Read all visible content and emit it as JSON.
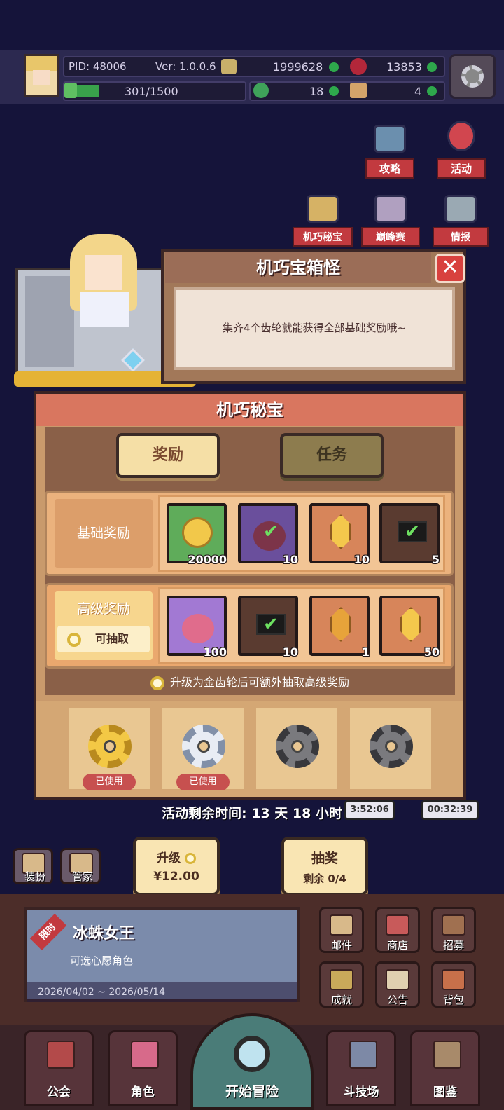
{
  "topbar": {
    "pid": "PID: 48006",
    "version": "Ver: 1.0.0.6",
    "gold": "1999628",
    "gems": "13853",
    "stamina": "301/1500",
    "clover": "18",
    "item": "4"
  },
  "side": {
    "guide": "攻略",
    "activity": "活动",
    "secret": "机巧秘宝",
    "peak": "巅峰赛",
    "intel": "情报"
  },
  "dialog": {
    "title": "机巧宝箱怪",
    "message": "集齐4个齿轮就能获得全部基础奖励哦~"
  },
  "panel": {
    "title": "机巧秘宝",
    "tab_reward": "奖励",
    "tab_task": "任务",
    "basic_label": "基础奖励",
    "advanced_label": "高级奖励",
    "draw_label": "可抽取",
    "basic_items": [
      {
        "name": "gold-coin",
        "count": "20000"
      },
      {
        "name": "purple-fruit",
        "count": "10"
      },
      {
        "name": "gold-crystal",
        "count": "10"
      },
      {
        "name": "check-ticket",
        "count": "5"
      }
    ],
    "advanced_items": [
      {
        "name": "pink-fruit",
        "count": "100"
      },
      {
        "name": "check-ticket",
        "count": "10"
      },
      {
        "name": "amber-crystal",
        "count": "1"
      },
      {
        "name": "gold-crystal",
        "count": "50"
      }
    ],
    "hint": "升级为金齿轮后可额外抽取高级奖励",
    "gears": [
      {
        "type": "gold",
        "status": "已使用"
      },
      {
        "type": "silver",
        "status": "已使用"
      },
      {
        "type": "gray",
        "status": ""
      },
      {
        "type": "gray",
        "status": ""
      }
    ]
  },
  "remaining_time": "活动剩余时间: 13 天 18 小时",
  "timers": [
    "3:52:06",
    "00:32:39"
  ],
  "upgrade_btn": {
    "label": "升级",
    "price": "¥12.00"
  },
  "lottery_btn": {
    "label": "抽奖",
    "remaining": "剩余 0/4"
  },
  "left_btns": {
    "dress": "装扮",
    "butler": "管家"
  },
  "banner": {
    "tag": "限时",
    "name": "冰蛛女王",
    "sub": "可选心愿角色",
    "date": "2026/04/02 ~ 2026/05/14"
  },
  "menu": {
    "mail": "邮件",
    "shop": "商店",
    "recruit": "招募",
    "achievement": "成就",
    "notice": "公告",
    "bag": "背包"
  },
  "nav": {
    "guild": "公会",
    "character": "角色",
    "adventure": "开始冒险",
    "arena": "斗技场",
    "codex": "图鉴"
  },
  "colors": {
    "accent_red": "#c23a3f",
    "panel": "#c99a6c",
    "gold": "#f3c845"
  }
}
